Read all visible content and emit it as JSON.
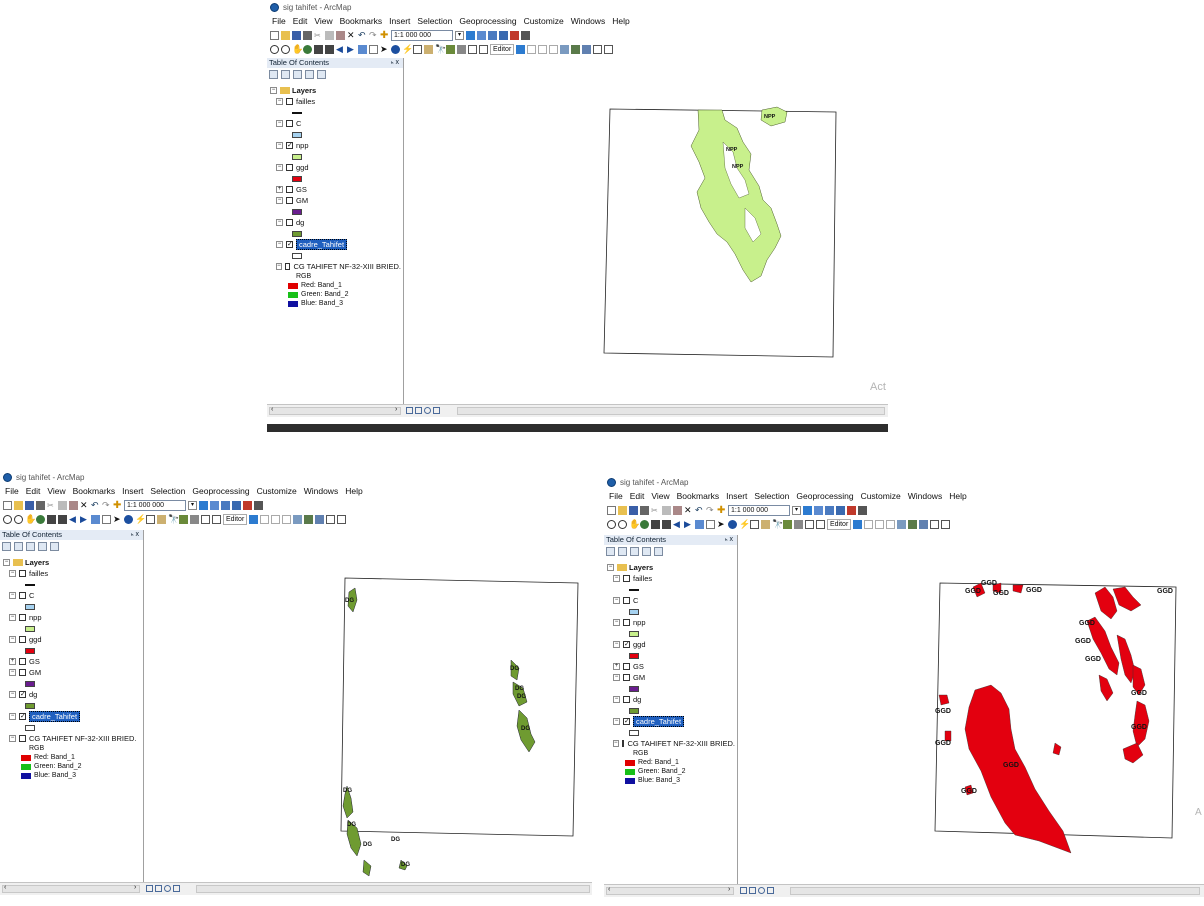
{
  "colors": {
    "npp": "#c8f08c",
    "ggd": "#e3000f",
    "dg": "#6f9b31",
    "C": "#a6d2f0",
    "GM": "#6a1d8f",
    "red_band": "#e00000",
    "green_band": "#18c018",
    "blue_band": "#1010a0",
    "selection": "#1f5fbf"
  },
  "app": {
    "title": "sig tahifet - ArcMap"
  },
  "menu": [
    "File",
    "Edit",
    "View",
    "Bookmarks",
    "Insert",
    "Selection",
    "Geoprocessing",
    "Customize",
    "Windows",
    "Help"
  ],
  "toolbar": {
    "scale_value": "1:1 000 000",
    "editor_label": "Editor"
  },
  "toc": {
    "title": "Table Of Contents",
    "pin_close": "ₕ x",
    "group_label": "Layers",
    "layer_names": [
      "failles",
      "C",
      "npp",
      "ggd",
      "GS",
      "GM",
      "dg",
      "cadre_Tahifet",
      "CG TAHIFET NF-32-XIII BRIED."
    ],
    "rgb_label": "RGB",
    "bands": [
      "Red:   Band_1",
      "Green: Band_2",
      "Blue:  Band_3"
    ]
  },
  "windows": [
    {
      "checked": {
        "failles": false,
        "C": false,
        "npp": true,
        "ggd": false,
        "GS": false,
        "GM": false,
        "dg": false,
        "cadre_Tahifet": true,
        "CG": false
      },
      "map_labels": [
        "NPP",
        "NPP",
        "NPP"
      ],
      "watermark": "Act"
    },
    {
      "checked": {
        "failles": false,
        "C": false,
        "npp": false,
        "ggd": false,
        "GS": false,
        "GM": false,
        "dg": true,
        "cadre_Tahifet": true,
        "CG": false
      },
      "map_labels": [
        "DG",
        "DG",
        "DG",
        "DG",
        "DG",
        "DG",
        "DG",
        "DG",
        "DG",
        "DG"
      ],
      "watermark": ""
    },
    {
      "checked": {
        "failles": false,
        "C": false,
        "npp": false,
        "ggd": true,
        "GS": false,
        "GM": false,
        "dg": false,
        "cadre_Tahifet": true,
        "CG": false
      },
      "map_labels": [
        "GGD",
        "GGD",
        "GGD",
        "GGD",
        "GGD",
        "GGD",
        "GGD",
        "GGD",
        "GGD",
        "GGD",
        "GGD",
        "GGD",
        "GGD",
        "GGD"
      ],
      "watermark": "A"
    }
  ]
}
